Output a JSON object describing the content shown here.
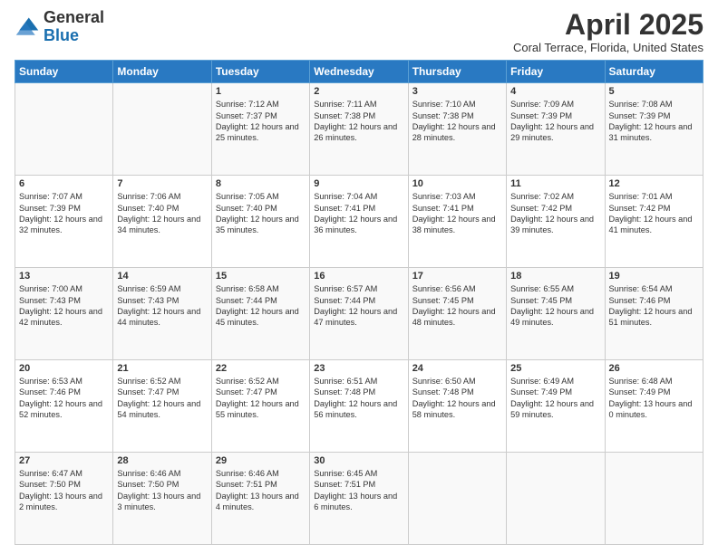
{
  "header": {
    "logo_general": "General",
    "logo_blue": "Blue",
    "month_title": "April 2025",
    "location": "Coral Terrace, Florida, United States"
  },
  "days_of_week": [
    "Sunday",
    "Monday",
    "Tuesday",
    "Wednesday",
    "Thursday",
    "Friday",
    "Saturday"
  ],
  "weeks": [
    [
      null,
      null,
      {
        "day": 1,
        "sunrise": "Sunrise: 7:12 AM",
        "sunset": "Sunset: 7:37 PM",
        "daylight": "Daylight: 12 hours and 25 minutes."
      },
      {
        "day": 2,
        "sunrise": "Sunrise: 7:11 AM",
        "sunset": "Sunset: 7:38 PM",
        "daylight": "Daylight: 12 hours and 26 minutes."
      },
      {
        "day": 3,
        "sunrise": "Sunrise: 7:10 AM",
        "sunset": "Sunset: 7:38 PM",
        "daylight": "Daylight: 12 hours and 28 minutes."
      },
      {
        "day": 4,
        "sunrise": "Sunrise: 7:09 AM",
        "sunset": "Sunset: 7:39 PM",
        "daylight": "Daylight: 12 hours and 29 minutes."
      },
      {
        "day": 5,
        "sunrise": "Sunrise: 7:08 AM",
        "sunset": "Sunset: 7:39 PM",
        "daylight": "Daylight: 12 hours and 31 minutes."
      }
    ],
    [
      {
        "day": 6,
        "sunrise": "Sunrise: 7:07 AM",
        "sunset": "Sunset: 7:39 PM",
        "daylight": "Daylight: 12 hours and 32 minutes."
      },
      {
        "day": 7,
        "sunrise": "Sunrise: 7:06 AM",
        "sunset": "Sunset: 7:40 PM",
        "daylight": "Daylight: 12 hours and 34 minutes."
      },
      {
        "day": 8,
        "sunrise": "Sunrise: 7:05 AM",
        "sunset": "Sunset: 7:40 PM",
        "daylight": "Daylight: 12 hours and 35 minutes."
      },
      {
        "day": 9,
        "sunrise": "Sunrise: 7:04 AM",
        "sunset": "Sunset: 7:41 PM",
        "daylight": "Daylight: 12 hours and 36 minutes."
      },
      {
        "day": 10,
        "sunrise": "Sunrise: 7:03 AM",
        "sunset": "Sunset: 7:41 PM",
        "daylight": "Daylight: 12 hours and 38 minutes."
      },
      {
        "day": 11,
        "sunrise": "Sunrise: 7:02 AM",
        "sunset": "Sunset: 7:42 PM",
        "daylight": "Daylight: 12 hours and 39 minutes."
      },
      {
        "day": 12,
        "sunrise": "Sunrise: 7:01 AM",
        "sunset": "Sunset: 7:42 PM",
        "daylight": "Daylight: 12 hours and 41 minutes."
      }
    ],
    [
      {
        "day": 13,
        "sunrise": "Sunrise: 7:00 AM",
        "sunset": "Sunset: 7:43 PM",
        "daylight": "Daylight: 12 hours and 42 minutes."
      },
      {
        "day": 14,
        "sunrise": "Sunrise: 6:59 AM",
        "sunset": "Sunset: 7:43 PM",
        "daylight": "Daylight: 12 hours and 44 minutes."
      },
      {
        "day": 15,
        "sunrise": "Sunrise: 6:58 AM",
        "sunset": "Sunset: 7:44 PM",
        "daylight": "Daylight: 12 hours and 45 minutes."
      },
      {
        "day": 16,
        "sunrise": "Sunrise: 6:57 AM",
        "sunset": "Sunset: 7:44 PM",
        "daylight": "Daylight: 12 hours and 47 minutes."
      },
      {
        "day": 17,
        "sunrise": "Sunrise: 6:56 AM",
        "sunset": "Sunset: 7:45 PM",
        "daylight": "Daylight: 12 hours and 48 minutes."
      },
      {
        "day": 18,
        "sunrise": "Sunrise: 6:55 AM",
        "sunset": "Sunset: 7:45 PM",
        "daylight": "Daylight: 12 hours and 49 minutes."
      },
      {
        "day": 19,
        "sunrise": "Sunrise: 6:54 AM",
        "sunset": "Sunset: 7:46 PM",
        "daylight": "Daylight: 12 hours and 51 minutes."
      }
    ],
    [
      {
        "day": 20,
        "sunrise": "Sunrise: 6:53 AM",
        "sunset": "Sunset: 7:46 PM",
        "daylight": "Daylight: 12 hours and 52 minutes."
      },
      {
        "day": 21,
        "sunrise": "Sunrise: 6:52 AM",
        "sunset": "Sunset: 7:47 PM",
        "daylight": "Daylight: 12 hours and 54 minutes."
      },
      {
        "day": 22,
        "sunrise": "Sunrise: 6:52 AM",
        "sunset": "Sunset: 7:47 PM",
        "daylight": "Daylight: 12 hours and 55 minutes."
      },
      {
        "day": 23,
        "sunrise": "Sunrise: 6:51 AM",
        "sunset": "Sunset: 7:48 PM",
        "daylight": "Daylight: 12 hours and 56 minutes."
      },
      {
        "day": 24,
        "sunrise": "Sunrise: 6:50 AM",
        "sunset": "Sunset: 7:48 PM",
        "daylight": "Daylight: 12 hours and 58 minutes."
      },
      {
        "day": 25,
        "sunrise": "Sunrise: 6:49 AM",
        "sunset": "Sunset: 7:49 PM",
        "daylight": "Daylight: 12 hours and 59 minutes."
      },
      {
        "day": 26,
        "sunrise": "Sunrise: 6:48 AM",
        "sunset": "Sunset: 7:49 PM",
        "daylight": "Daylight: 13 hours and 0 minutes."
      }
    ],
    [
      {
        "day": 27,
        "sunrise": "Sunrise: 6:47 AM",
        "sunset": "Sunset: 7:50 PM",
        "daylight": "Daylight: 13 hours and 2 minutes."
      },
      {
        "day": 28,
        "sunrise": "Sunrise: 6:46 AM",
        "sunset": "Sunset: 7:50 PM",
        "daylight": "Daylight: 13 hours and 3 minutes."
      },
      {
        "day": 29,
        "sunrise": "Sunrise: 6:46 AM",
        "sunset": "Sunset: 7:51 PM",
        "daylight": "Daylight: 13 hours and 4 minutes."
      },
      {
        "day": 30,
        "sunrise": "Sunrise: 6:45 AM",
        "sunset": "Sunset: 7:51 PM",
        "daylight": "Daylight: 13 hours and 6 minutes."
      },
      null,
      null,
      null
    ]
  ]
}
